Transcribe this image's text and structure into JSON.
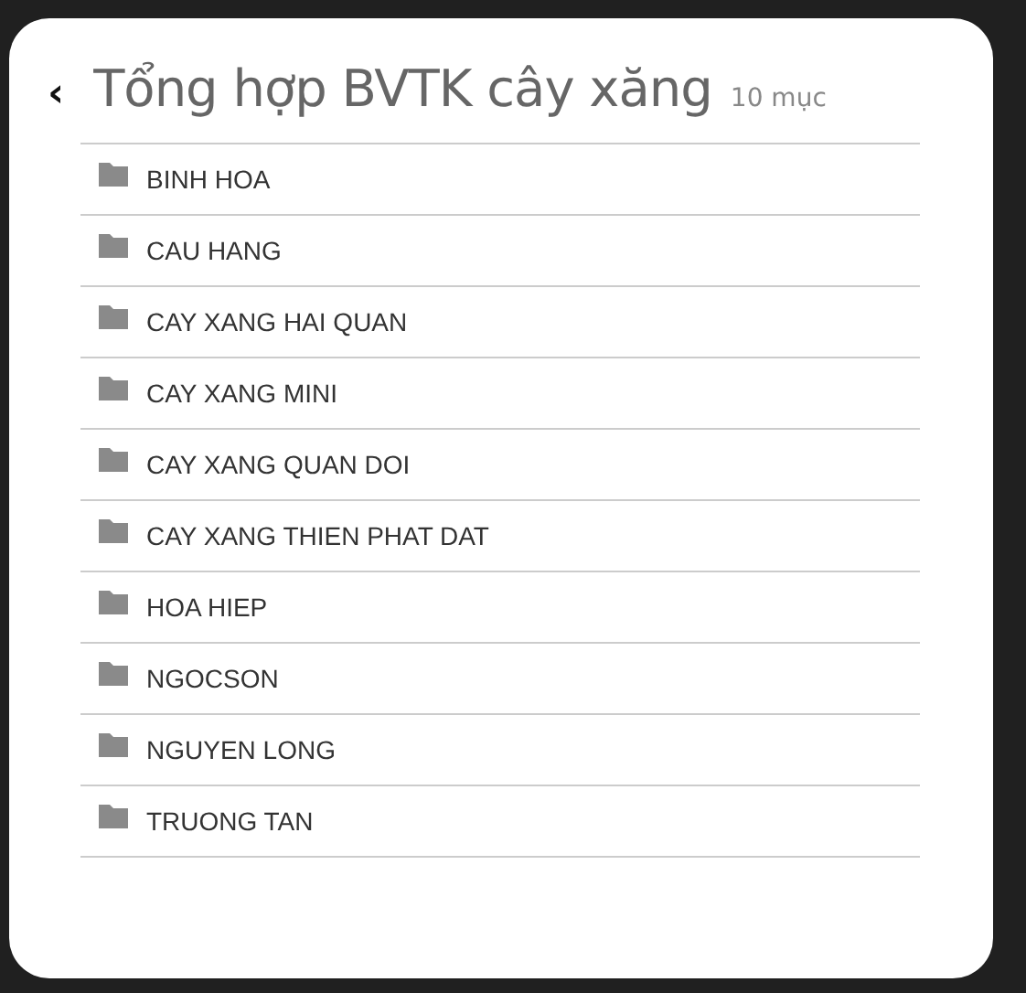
{
  "header": {
    "back": "‹",
    "title": "Tổng hợp BVTK cây xăng",
    "count": "10 mục"
  },
  "folders": [
    {
      "name": "BINH HOA"
    },
    {
      "name": "CAU HANG"
    },
    {
      "name": "CAY XANG HAI QUAN"
    },
    {
      "name": "CAY XANG MINI"
    },
    {
      "name": "CAY XANG QUAN DOI"
    },
    {
      "name": "CAY XANG THIEN PHAT DAT"
    },
    {
      "name": "HOA HIEP"
    },
    {
      "name": "NGOCSON"
    },
    {
      "name": "NGUYEN LONG"
    },
    {
      "name": "TRUONG TAN"
    }
  ]
}
